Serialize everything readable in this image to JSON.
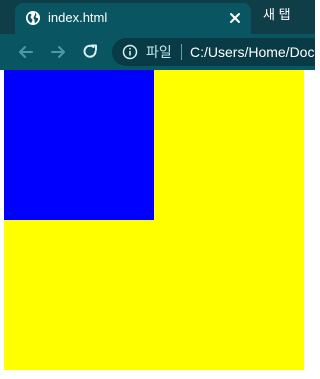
{
  "browser": {
    "tab": {
      "title": "index.html",
      "favicon": "globe-icon",
      "close_icon": "close-icon"
    },
    "new_tab_label": "새 탭",
    "toolbar": {
      "back_icon": "back-arrow-icon",
      "forward_icon": "forward-arrow-icon",
      "reload_icon": "reload-icon",
      "info_icon": "info-icon",
      "scheme_label": "파일",
      "url": "C:/Users/Home/Doc"
    }
  },
  "page": {
    "yellow_box_color": "#ffff00",
    "blue_box_color": "#0000ff"
  }
}
